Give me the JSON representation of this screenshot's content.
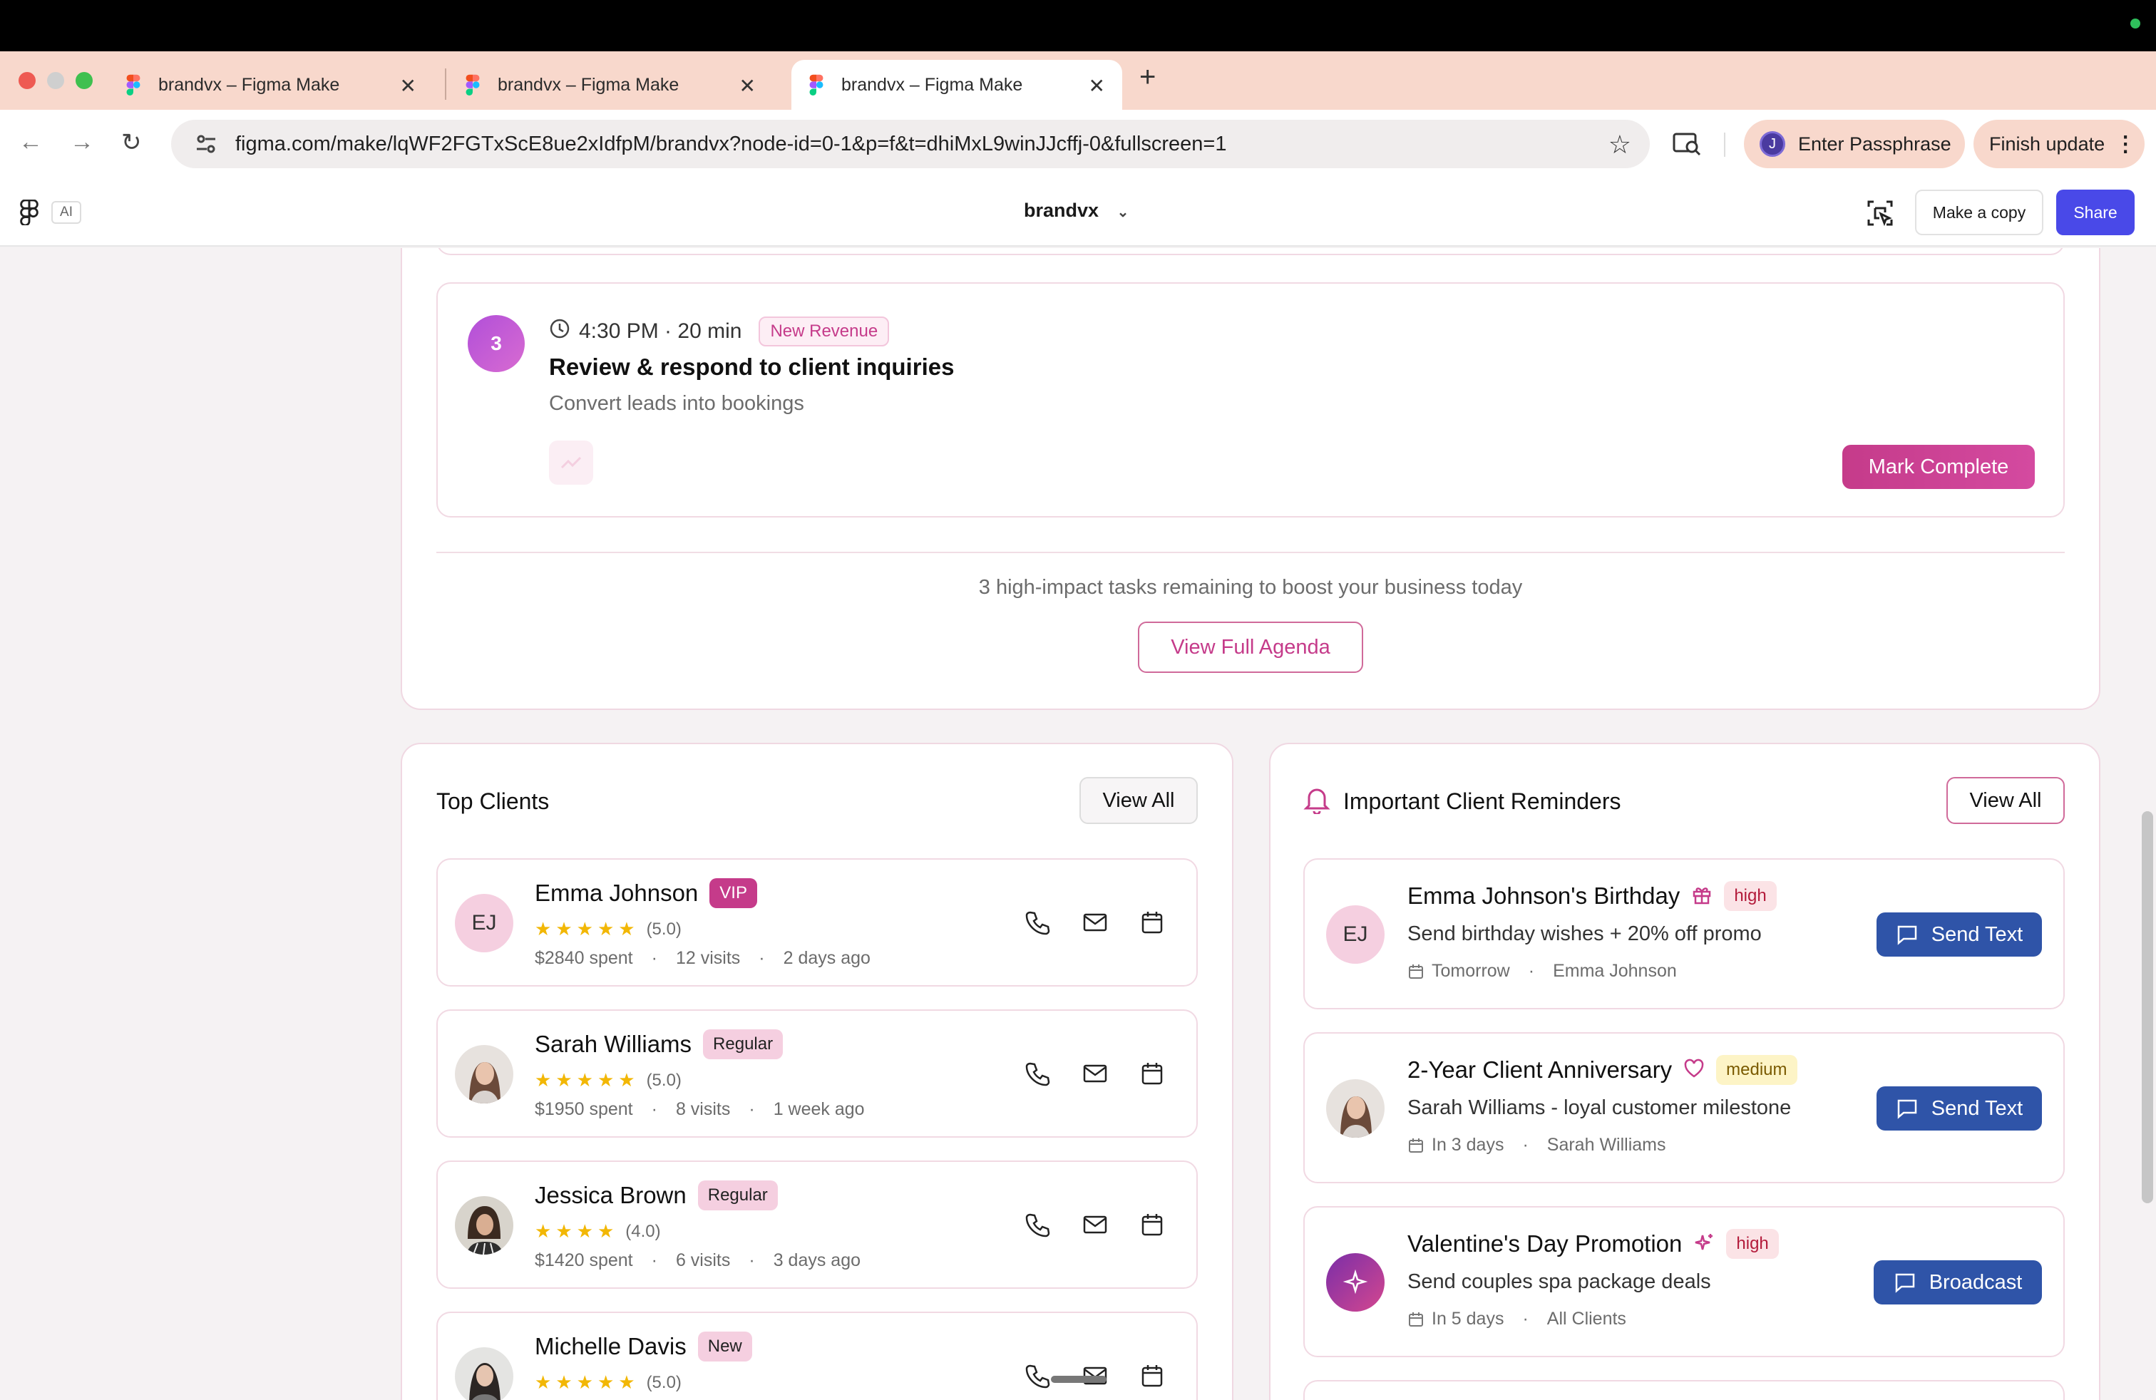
{
  "browser": {
    "tabs": [
      {
        "title": "brandvx – Figma Make"
      },
      {
        "title": "brandvx – Figma Make"
      },
      {
        "title": "brandvx – Figma Make"
      }
    ],
    "new_tab": "+",
    "url": "figma.com/make/lqWF2FGTxScE8ue2xIdfpM/brandvx?node-id=0-1&p=f&t=dhiMxL9winJJcffj-0&fullscreen=1",
    "profile_initial": "J",
    "passphrase_label": "Enter Passphrase",
    "update_label": "Finish update"
  },
  "figma_header": {
    "ai_label": "AI",
    "doc_title": "brandvx",
    "make_copy_label": "Make a copy",
    "share_label": "Share"
  },
  "agenda": {
    "task": {
      "number": "3",
      "time": "4:30 PM · 20 min",
      "tag": "New Revenue",
      "title": "Review & respond to client inquiries",
      "subtitle": "Convert leads into bookings",
      "action": "Mark Complete"
    },
    "summary": "3 high-impact tasks remaining to boost your business today",
    "view_full_label": "View Full Agenda"
  },
  "top_clients": {
    "title": "Top Clients",
    "view_all": "View All",
    "clients": [
      {
        "name": "Emma Johnson",
        "initials": "EJ",
        "badge": "VIP",
        "rating": "(5.0)",
        "stars": 5,
        "spent": "$2840 spent",
        "visits": "12 visits",
        "last": "2 days ago"
      },
      {
        "name": "Sarah Williams",
        "initials": "",
        "badge": "Regular",
        "rating": "(5.0)",
        "stars": 5,
        "spent": "$1950 spent",
        "visits": "8 visits",
        "last": "1 week ago"
      },
      {
        "name": "Jessica Brown",
        "initials": "",
        "badge": "Regular",
        "rating": "(4.0)",
        "stars": 4,
        "spent": "$1420 spent",
        "visits": "6 visits",
        "last": "3 days ago"
      },
      {
        "name": "Michelle Davis",
        "initials": "",
        "badge": "New",
        "rating": "(5.0)",
        "stars": 5,
        "spent": "",
        "visits": "",
        "last": ""
      }
    ]
  },
  "reminders": {
    "title": "Important Client Reminders",
    "view_all": "View All",
    "items": [
      {
        "title": "Emma Johnson's Birthday",
        "initials": "EJ",
        "priority": "high",
        "desc": "Send birthday wishes + 20% off promo",
        "when": "Tomorrow",
        "who": "Emma Johnson",
        "action": "Send Text"
      },
      {
        "title": "2-Year Client Anniversary",
        "initials": "",
        "priority": "medium",
        "desc": "Sarah Williams - loyal customer milestone",
        "when": "In 3 days",
        "who": "Sarah Williams",
        "action": "Send Text"
      },
      {
        "title": "Valentine's Day Promotion",
        "initials": "",
        "priority": "high",
        "desc": "Send couples spa package deals",
        "when": "In 5 days",
        "who": "All Clients",
        "action": "Broadcast"
      }
    ]
  },
  "colors": {
    "brand_pink": "#c53b8a",
    "share_blue": "#4949e8",
    "action_blue": "#2f54a8",
    "high_badge_bg": "#fbe3e6",
    "medium_badge_bg": "#fdf4c6"
  },
  "icons": [
    "figma-icon",
    "clock-icon",
    "trend-icon",
    "phone-icon",
    "mail-icon",
    "calendar-icon",
    "bell-icon",
    "gift-icon",
    "heart-icon",
    "sparkle-icon",
    "chat-icon",
    "star-icon"
  ]
}
